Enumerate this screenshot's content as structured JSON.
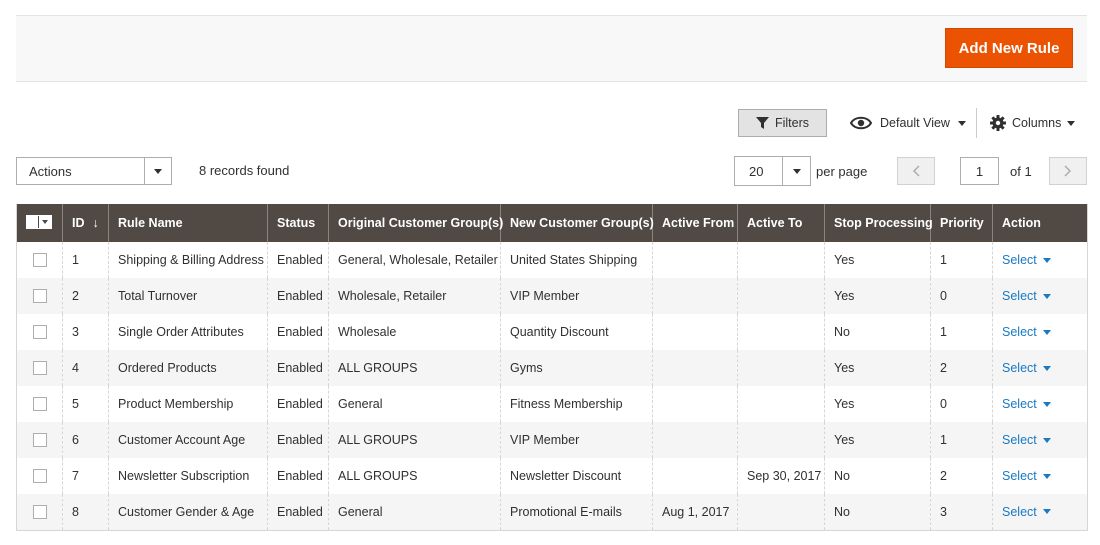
{
  "header": {
    "add_button_label": "Add New Rule"
  },
  "toolbar": {
    "filters_label": "Filters",
    "view_label": "Default View",
    "columns_label": "Columns"
  },
  "massactions": {
    "actions_label": "Actions",
    "records_found": "8 records found"
  },
  "pagination": {
    "page_size": "20",
    "per_page_label": "per page",
    "current_page": "1",
    "of_label": "of 1",
    "prev_icon": "chevron-left-icon",
    "next_icon": "chevron-right-icon"
  },
  "colors": {
    "accent": "#eb5202",
    "header_bg": "#514943",
    "link": "#1979c3"
  },
  "table": {
    "columns": [
      "ID",
      "Rule Name",
      "Status",
      "Original Customer Group(s)",
      "New Customer Group(s)",
      "Active From",
      "Active To",
      "Stop Processing",
      "Priority",
      "Action"
    ],
    "sort_indicator": "↓",
    "rows": [
      {
        "id": "1",
        "name": "Shipping & Billing Address",
        "status": "Enabled",
        "original": "General, Wholesale, Retailer",
        "new": "United States Shipping",
        "from": "",
        "to": "",
        "stop": "Yes",
        "priority": "1",
        "action": "Select"
      },
      {
        "id": "2",
        "name": "Total Turnover",
        "status": "Enabled",
        "original": "Wholesale, Retailer",
        "new": "VIP Member",
        "from": "",
        "to": "",
        "stop": "Yes",
        "priority": "0",
        "action": "Select"
      },
      {
        "id": "3",
        "name": "Single Order Attributes",
        "status": "Enabled",
        "original": "Wholesale",
        "new": "Quantity Discount",
        "from": "",
        "to": "",
        "stop": "No",
        "priority": "1",
        "action": "Select"
      },
      {
        "id": "4",
        "name": "Ordered Products",
        "status": "Enabled",
        "original": "ALL GROUPS",
        "new": "Gyms",
        "from": "",
        "to": "",
        "stop": "Yes",
        "priority": "2",
        "action": "Select"
      },
      {
        "id": "5",
        "name": "Product Membership",
        "status": "Enabled",
        "original": "General",
        "new": "Fitness Membership",
        "from": "",
        "to": "",
        "stop": "Yes",
        "priority": "0",
        "action": "Select"
      },
      {
        "id": "6",
        "name": "Customer Account Age",
        "status": "Enabled",
        "original": "ALL GROUPS",
        "new": "VIP Member",
        "from": "",
        "to": "",
        "stop": "Yes",
        "priority": "1",
        "action": "Select"
      },
      {
        "id": "7",
        "name": "Newsletter Subscription",
        "status": "Enabled",
        "original": "ALL GROUPS",
        "new": "Newsletter Discount",
        "from": "",
        "to": "Sep 30, 2017",
        "stop": "No",
        "priority": "2",
        "action": "Select"
      },
      {
        "id": "8",
        "name": "Customer Gender & Age",
        "status": "Enabled",
        "original": "General",
        "new": "Promotional E-mails",
        "from": "Aug 1, 2017",
        "to": "",
        "stop": "No",
        "priority": "3",
        "action": "Select"
      }
    ]
  }
}
